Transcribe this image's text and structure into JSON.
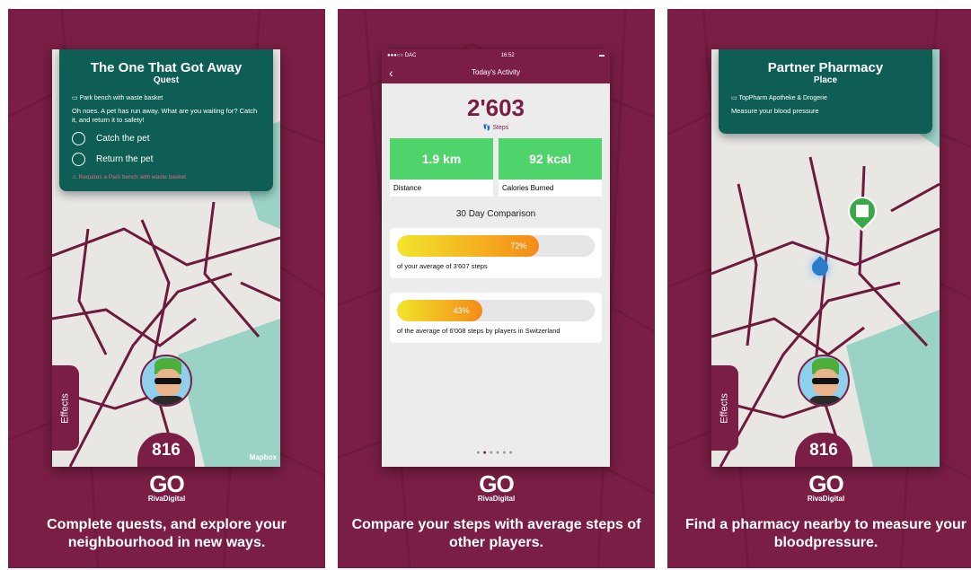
{
  "panels": [
    {
      "card": {
        "title": "The One That Got Away",
        "subtitle": "Quest",
        "location": "Park bench with waste basket",
        "description": "Oh noes. A pet has run away. What are you waiting for? Catch it, and return it to safety!",
        "options": [
          "Catch the pet",
          "Return the pet"
        ],
        "requirement": "Requires a Park bench with waste basket"
      },
      "effects_label": "Effects",
      "level": "816",
      "attribution": "Mapbox",
      "caption": "Complete quests, and explore your neighbourhood in new ways."
    },
    {
      "status": {
        "carrier": "●●●○○ DAC",
        "time": "16:52"
      },
      "title": "Today's Activity",
      "steps": "2'603",
      "steps_label": "Steps",
      "tiles": [
        {
          "value": "1.9 km",
          "label": "Distance"
        },
        {
          "value": "92 kcal",
          "label": "Calories Burned"
        }
      ],
      "comparison_title": "30 Day Comparison",
      "bars": [
        {
          "percent": 72,
          "percent_label": "72%",
          "text": "of your average of 3'607 steps"
        },
        {
          "percent": 43,
          "percent_label": "43%",
          "text": "of the average of 6'008 steps by players in Switzerland"
        }
      ],
      "caption": "Compare your steps with average steps of other players."
    },
    {
      "card": {
        "title": "Partner Pharmacy",
        "subtitle": "Place",
        "location": "TopPharm Apotheke & Drogerie",
        "description": "Measure your blood pressure"
      },
      "effects_label": "Effects",
      "level": "816",
      "caption": "Find a pharmacy nearby to measure your bloodpressure."
    }
  ],
  "logo": {
    "mark": "GO",
    "brand": "RivaDigital"
  },
  "colors": {
    "brand": "#7a1e45",
    "card": "#0f5e55",
    "tile": "#4fd36b",
    "water": "#9ad3c6",
    "road": "#6e1a3d"
  }
}
